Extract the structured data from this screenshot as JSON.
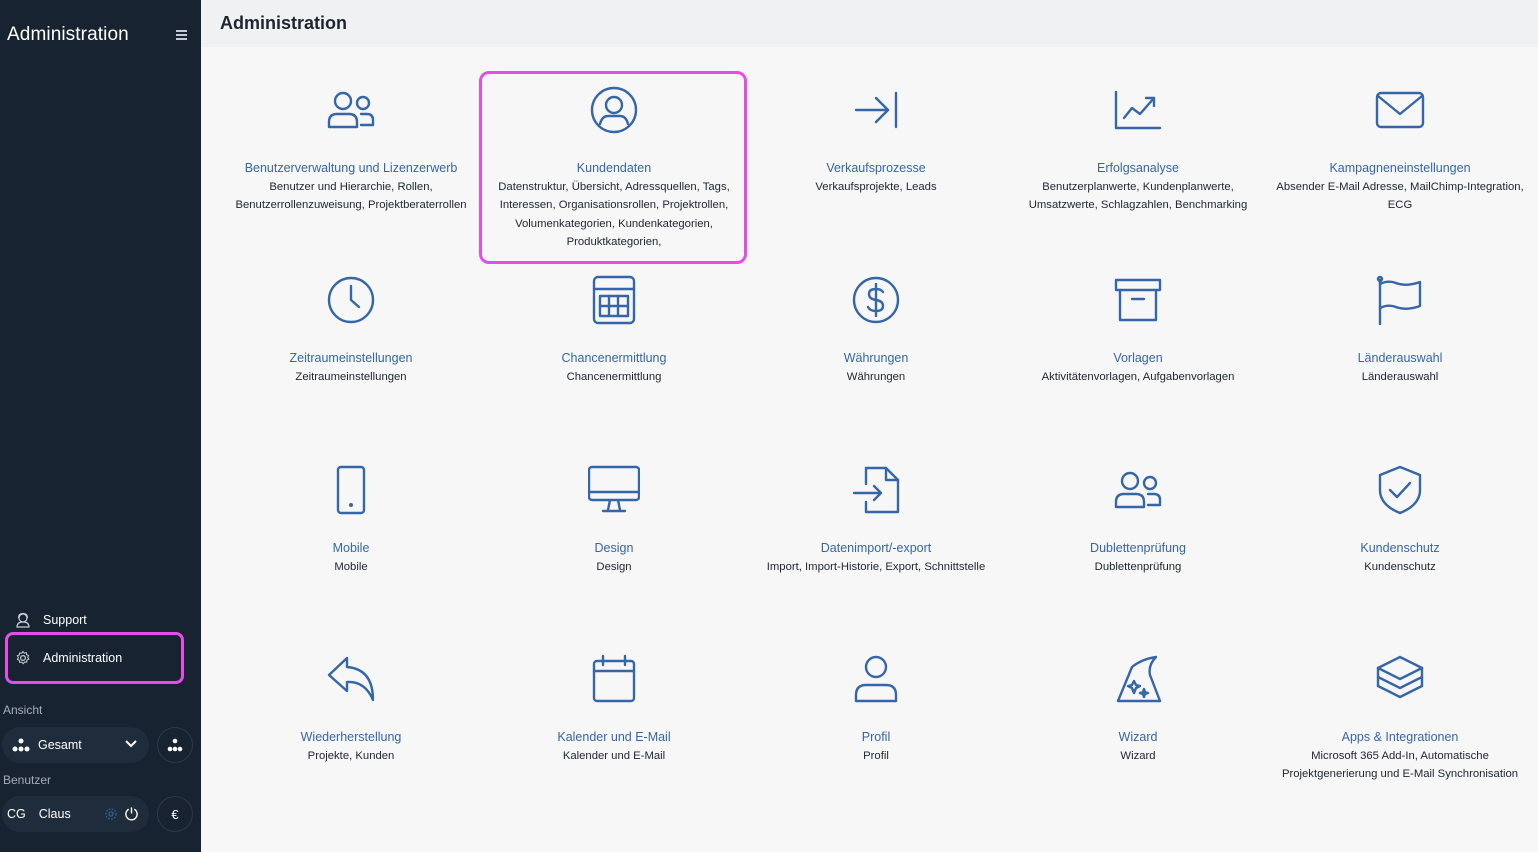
{
  "sidebar": {
    "title": "Administration",
    "support_label": "Support",
    "admin_label": "Administration",
    "view_heading": "Ansicht",
    "view_value": "Gesamt",
    "user_heading": "Benutzer",
    "user_initials": "CG",
    "user_name": "Claus",
    "currency_symbol": "€"
  },
  "header": {
    "title": "Administration"
  },
  "tiles": [
    {
      "title": "Benutzerverwaltung und Lizenzerwerb",
      "desc": "Benutzer und Hierarchie, Rollen, Benutzerrollenzuweisung, Projektberaterrollen",
      "icon": "users-icon"
    },
    {
      "title": "Kundendaten",
      "desc": "Datenstruktur, Übersicht, Adressquellen, Tags, Interessen, Organisationsrollen, Projektrollen, Volumenkategorien, Kundenkategorien, Produktkategorien,",
      "icon": "user-circle-icon"
    },
    {
      "title": "Verkaufsprozesse",
      "desc": "Verkaufsprojekte, Leads",
      "icon": "arrow-to-line-icon"
    },
    {
      "title": "Erfolgsanalyse",
      "desc": "Benutzerplanwerte, Kundenplanwerte, Umsatzwerte, Schlagzahlen, Benchmarking",
      "icon": "trend-chart-icon"
    },
    {
      "title": "Kampagneneinstellungen",
      "desc": "Absender E-Mail Adresse, MailChimp-Integration, ECG",
      "icon": "envelope-icon"
    },
    {
      "title": "Zeitraumeinstellungen",
      "desc": "Zeitraumeinstellungen",
      "icon": "clock-icon"
    },
    {
      "title": "Chancenermittlung",
      "desc": "Chancenermittlung",
      "icon": "calculator-icon"
    },
    {
      "title": "Währungen",
      "desc": "Währungen",
      "icon": "dollar-icon"
    },
    {
      "title": "Vorlagen",
      "desc": "Aktivitätenvorlagen, Aufgabenvorlagen",
      "icon": "archive-box-icon"
    },
    {
      "title": "Länderauswahl",
      "desc": "Länderauswahl",
      "icon": "flag-icon"
    },
    {
      "title": "Mobile",
      "desc": "Mobile",
      "icon": "phone-icon"
    },
    {
      "title": "Design",
      "desc": "Design",
      "icon": "monitor-icon"
    },
    {
      "title": "Datenimport/-export",
      "desc": "Import, Import-Historie, Export, Schnittstelle",
      "icon": "file-import-icon"
    },
    {
      "title": "Dublettenprüfung",
      "desc": "Dublettenprüfung",
      "icon": "users-duplicate-icon"
    },
    {
      "title": "Kundenschutz",
      "desc": "Kundenschutz",
      "icon": "shield-check-icon"
    },
    {
      "title": "Wiederherstellung",
      "desc": "Projekte, Kunden",
      "icon": "reply-arrow-icon"
    },
    {
      "title": "Kalender und E-Mail",
      "desc": "Kalender und E-Mail",
      "icon": "calendar-icon"
    },
    {
      "title": "Profil",
      "desc": "Profil",
      "icon": "user-icon"
    },
    {
      "title": "Wizard",
      "desc": "Wizard",
      "icon": "wizard-hat-icon"
    },
    {
      "title": "Apps & Integrationen",
      "desc": "Microsoft 365 Add-In, Automatische Projektgenerierung und E-Mail Synchronisation",
      "icon": "layers-icon"
    }
  ],
  "colors": {
    "sidebar_bg": "#172331",
    "accent": "#3566a8",
    "highlight": "#e64ce6"
  }
}
